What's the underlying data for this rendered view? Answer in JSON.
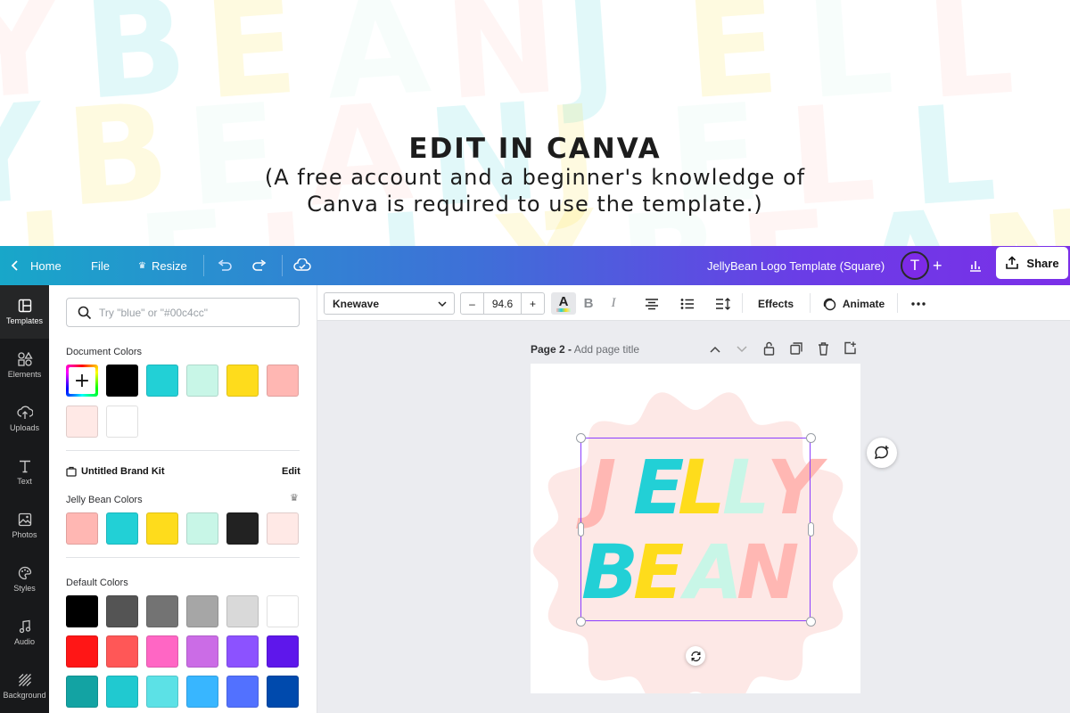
{
  "hero": {
    "title": "EDIT IN CANVA",
    "subtitle_line1": "(A free account and a beginner's knowledge of",
    "subtitle_line2": "Canva is required to use the template.)",
    "background_word": "JELLYBEAN"
  },
  "topbar": {
    "home_label": "Home",
    "file_label": "File",
    "resize_label": "Resize",
    "document_title": "JellyBean Logo Template (Square)",
    "avatar_initial": "T",
    "share_label": "Share"
  },
  "rail": {
    "items": [
      {
        "label": "Templates",
        "icon": "templates-icon"
      },
      {
        "label": "Elements",
        "icon": "elements-icon"
      },
      {
        "label": "Uploads",
        "icon": "uploads-icon"
      },
      {
        "label": "Text",
        "icon": "text-icon"
      },
      {
        "label": "Photos",
        "icon": "photos-icon"
      },
      {
        "label": "Styles",
        "icon": "styles-icon"
      },
      {
        "label": "Audio",
        "icon": "audio-icon"
      },
      {
        "label": "Background",
        "icon": "background-icon"
      }
    ]
  },
  "panel": {
    "search_placeholder": "Try \"blue\" or \"#00c4cc\"",
    "document_colors_title": "Document Colors",
    "document_colors": [
      "#000000",
      "#22d0d6",
      "#c8f6e7",
      "#fedc1c",
      "#ffb7b3",
      "#ffe9e6",
      "#ffffff"
    ],
    "brand_kit_title": "Untitled Brand Kit",
    "brand_kit_edit": "Edit",
    "brand_colors_title": "Jelly Bean Colors",
    "brand_colors": [
      "#ffb7b3",
      "#22d0d6",
      "#fedc1c",
      "#c8f6e7",
      "#222222",
      "#ffe9e6"
    ],
    "default_colors_title": "Default Colors",
    "default_colors": [
      [
        "#000000",
        "#545454",
        "#737373",
        "#a6a6a6",
        "#d9d9d9",
        "#ffffff"
      ],
      [
        "#ff1616",
        "#ff5757",
        "#ff66c4",
        "#cb6ce6",
        "#8c52ff",
        "#5e17eb"
      ],
      [
        "#13a3a3",
        "#20c9d0",
        "#5ce1e6",
        "#38b6ff",
        "#5271ff",
        "#004aad"
      ]
    ]
  },
  "toolbar": {
    "font_name": "Knewave",
    "font_size": "94.6",
    "minus": "–",
    "plus": "+",
    "bold": "B",
    "italic": "I",
    "effects_label": "Effects",
    "animate_label": "Animate"
  },
  "page": {
    "label_prefix": "Page 2 -",
    "label_placeholder": "Add page title"
  },
  "logo": {
    "line1_letters": [
      "J",
      "E",
      "L",
      "L",
      "Y"
    ],
    "line1_colors": [
      "#ffb7b3",
      "#22d0d6",
      "#fedc1c",
      "#c8f6e7",
      "#ffb7b3"
    ],
    "line2_letters": [
      "B",
      "E",
      "A",
      "N"
    ],
    "line2_colors": [
      "#22d0d6",
      "#fedc1c",
      "#c8f6e7",
      "#ffb7b3"
    ],
    "badge_color": "#fde8e6"
  },
  "colors": {
    "accent_purple": "#8b3dff",
    "rail_bg": "#18191b"
  }
}
